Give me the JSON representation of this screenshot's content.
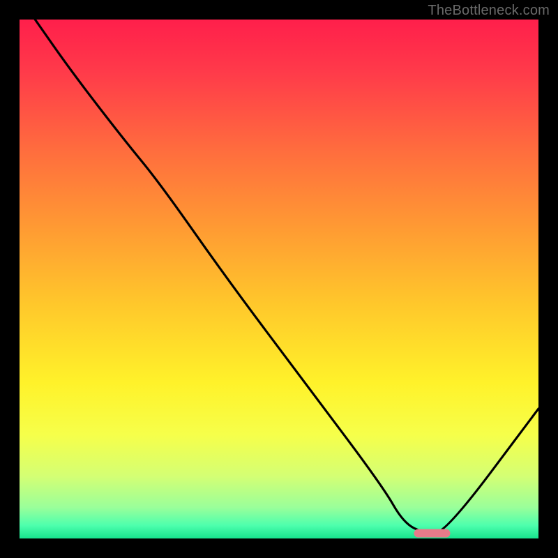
{
  "watermark": "TheBottleneck.com",
  "chart_data": {
    "type": "line",
    "title": "",
    "xlabel": "",
    "ylabel": "",
    "xlim": [
      0,
      100
    ],
    "ylim": [
      0,
      100
    ],
    "grid": false,
    "legend": false,
    "series": [
      {
        "name": "bottleneck-curve",
        "x": [
          3,
          10,
          20,
          27,
          40,
          55,
          70,
          74,
          78,
          82,
          100
        ],
        "y": [
          100,
          90,
          77,
          68.5,
          50,
          30,
          10,
          3,
          1,
          1,
          25
        ]
      }
    ],
    "marker": {
      "name": "optimal-segment",
      "x_start": 76,
      "x_end": 83,
      "y": 1,
      "color": "#e87b8a"
    },
    "background_gradient": {
      "stops": [
        {
          "offset": 0,
          "color": "#ff1f4b"
        },
        {
          "offset": 0.1,
          "color": "#ff3a4a"
        },
        {
          "offset": 0.25,
          "color": "#ff6c3e"
        },
        {
          "offset": 0.4,
          "color": "#ff9a33"
        },
        {
          "offset": 0.55,
          "color": "#ffc82b"
        },
        {
          "offset": 0.7,
          "color": "#fff22a"
        },
        {
          "offset": 0.8,
          "color": "#f6ff4a"
        },
        {
          "offset": 0.88,
          "color": "#d4ff74"
        },
        {
          "offset": 0.94,
          "color": "#9aff9a"
        },
        {
          "offset": 0.975,
          "color": "#4dffad"
        },
        {
          "offset": 1.0,
          "color": "#17e38d"
        }
      ]
    }
  }
}
